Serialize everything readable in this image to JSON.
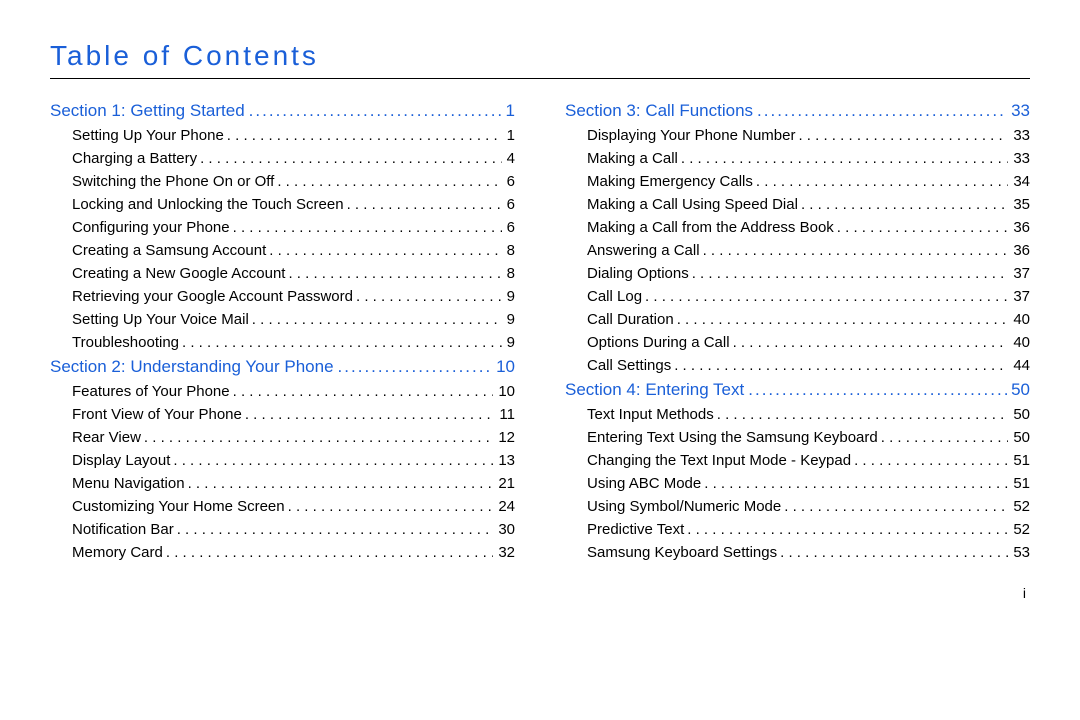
{
  "title": "Table of Contents",
  "footer": "i",
  "left": [
    {
      "head": {
        "label": "Section 1:  Getting Started",
        "page": "1"
      },
      "entries": [
        {
          "label": "Setting Up Your Phone",
          "page": "1"
        },
        {
          "label": "Charging a Battery",
          "page": "4"
        },
        {
          "label": "Switching the Phone On or Off",
          "page": "6"
        },
        {
          "label": "Locking and Unlocking the Touch Screen",
          "page": "6"
        },
        {
          "label": "Configuring your Phone",
          "page": "6"
        },
        {
          "label": "Creating a Samsung Account",
          "page": "8"
        },
        {
          "label": "Creating a New Google Account",
          "page": "8"
        },
        {
          "label": "Retrieving your Google Account Password",
          "page": "9"
        },
        {
          "label": "Setting Up Your Voice Mail",
          "page": "9"
        },
        {
          "label": "Troubleshooting",
          "page": "9"
        }
      ]
    },
    {
      "head": {
        "label": "Section 2:  Understanding Your Phone",
        "page": "10"
      },
      "entries": [
        {
          "label": "Features of Your Phone",
          "page": "10"
        },
        {
          "label": "Front View of Your Phone",
          "page": "11"
        },
        {
          "label": "Rear View",
          "page": "12"
        },
        {
          "label": "Display Layout",
          "page": "13"
        },
        {
          "label": "Menu Navigation",
          "page": "21"
        },
        {
          "label": "Customizing Your Home Screen",
          "page": "24"
        },
        {
          "label": "Notification Bar",
          "page": "30"
        },
        {
          "label": "Memory Card",
          "page": "32"
        }
      ]
    }
  ],
  "right": [
    {
      "head": {
        "label": "Section 3:  Call Functions",
        "page": "33"
      },
      "entries": [
        {
          "label": "Displaying Your Phone Number",
          "page": "33"
        },
        {
          "label": "Making a Call",
          "page": "33"
        },
        {
          "label": "Making Emergency Calls",
          "page": "34"
        },
        {
          "label": "Making a Call Using Speed Dial",
          "page": "35"
        },
        {
          "label": "Making a Call from the Address Book",
          "page": "36"
        },
        {
          "label": "Answering a Call",
          "page": "36"
        },
        {
          "label": "Dialing Options",
          "page": "37"
        },
        {
          "label": "Call Log",
          "page": "37"
        },
        {
          "label": "Call Duration",
          "page": "40"
        },
        {
          "label": "Options During a Call",
          "page": "40"
        },
        {
          "label": "Call Settings",
          "page": "44"
        }
      ]
    },
    {
      "head": {
        "label": "Section 4:  Entering Text",
        "page": "50"
      },
      "entries": [
        {
          "label": "Text Input Methods",
          "page": "50"
        },
        {
          "label": "Entering Text Using the Samsung Keyboard",
          "page": "50"
        },
        {
          "label": "Changing the Text Input Mode - Keypad",
          "page": "51"
        },
        {
          "label": "Using ABC Mode",
          "page": "51"
        },
        {
          "label": "Using Symbol/Numeric Mode",
          "page": "52"
        },
        {
          "label": "Predictive Text",
          "page": "52"
        },
        {
          "label": "Samsung Keyboard Settings",
          "page": "53"
        }
      ]
    }
  ]
}
